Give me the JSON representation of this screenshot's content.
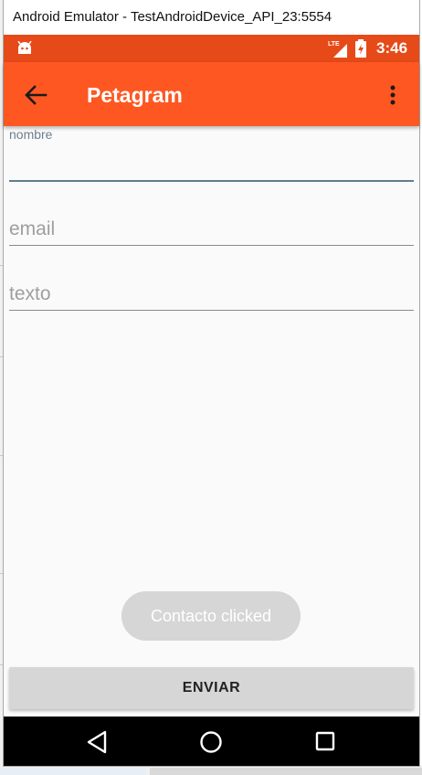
{
  "window": {
    "title": "Android Emulator - TestAndroidDevice_API_23:5554"
  },
  "status_bar": {
    "time": "3:46",
    "network": "LTE",
    "icons": [
      "android-notification-icon",
      "lte-signal-icon",
      "battery-charging-icon"
    ]
  },
  "app_bar": {
    "title": "Petagram",
    "back_icon": "arrow-left-icon",
    "menu_icon": "more-vert-icon"
  },
  "form": {
    "nombre": {
      "label": "nombre",
      "value": "",
      "placeholder": ""
    },
    "email": {
      "value": "",
      "placeholder": "email"
    },
    "texto": {
      "value": "",
      "placeholder": "texto"
    }
  },
  "toast": {
    "text": "Contacto clicked"
  },
  "send_button": {
    "label": "ENVIAR"
  },
  "nav_bar": {
    "icons": [
      "nav-back-icon",
      "nav-home-icon",
      "nav-recents-icon"
    ]
  },
  "colors": {
    "status_bar": "#e64a19",
    "app_bar": "#ff5722",
    "accent_line": "#607d8b",
    "background": "#fafafa"
  }
}
